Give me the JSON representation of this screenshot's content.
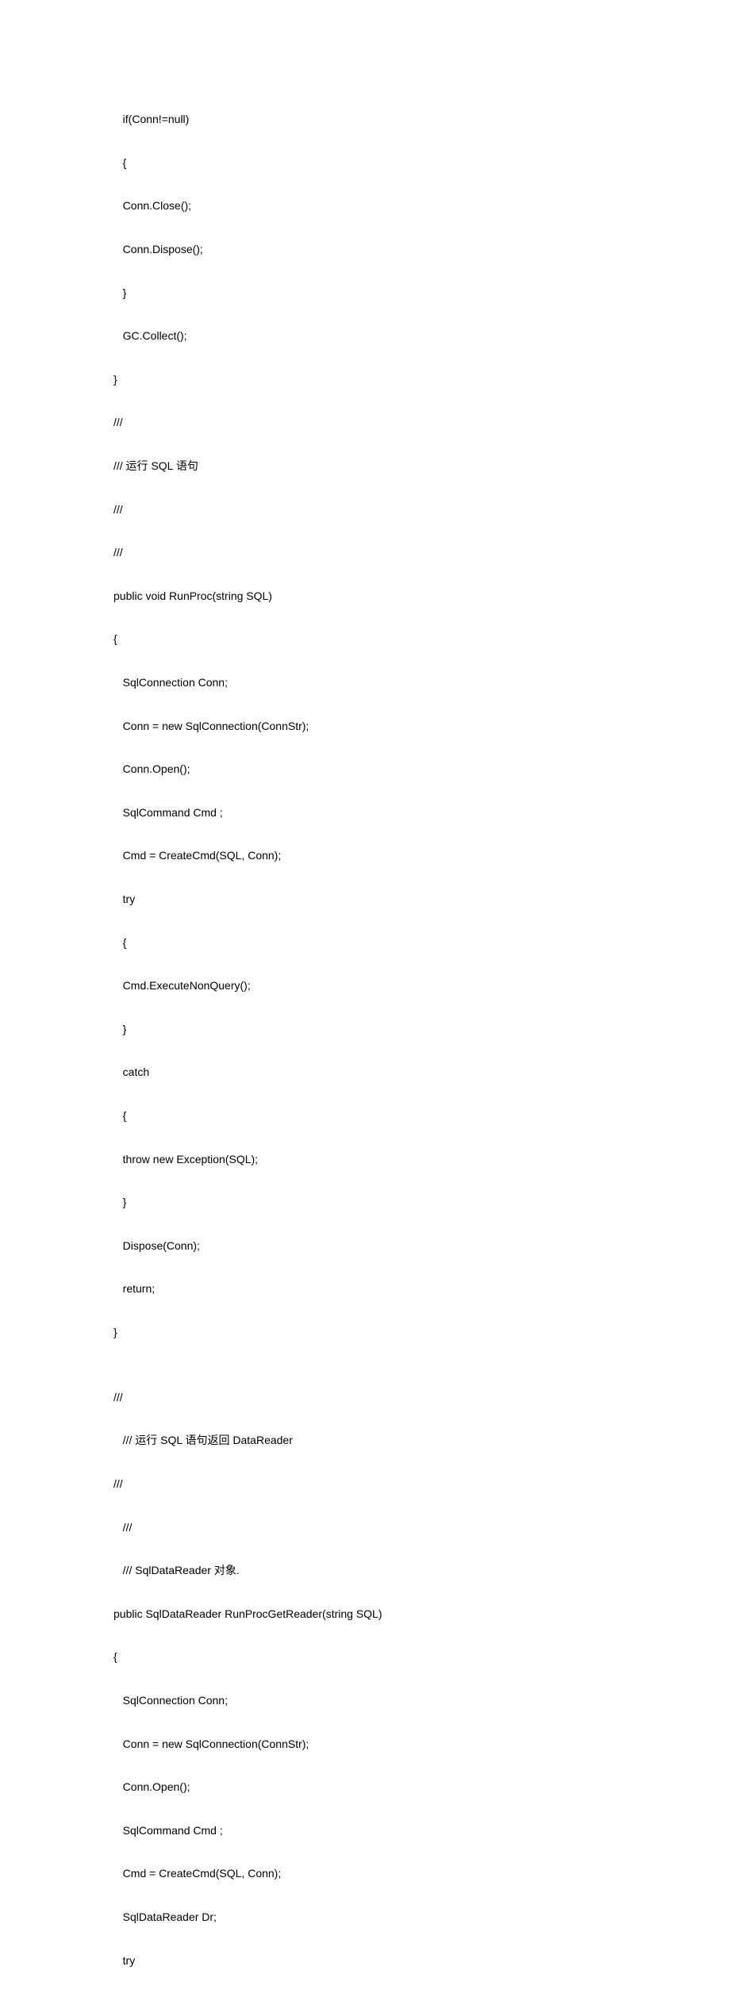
{
  "lines": [
    "   if(Conn!=null)",
    "   {",
    "   Conn.Close();",
    "   Conn.Dispose();",
    "   }",
    "   GC.Collect();",
    "}",
    "///",
    "/// 运行 SQL 语句",
    "///",
    "///",
    "public void RunProc(string SQL)",
    "{",
    "   SqlConnection Conn;",
    "   Conn = new SqlConnection(ConnStr);",
    "   Conn.Open();",
    "   SqlCommand Cmd ;",
    "   Cmd = CreateCmd(SQL, Conn);",
    "   try",
    "   {",
    "   Cmd.ExecuteNonQuery();",
    "   }",
    "   catch",
    "   {",
    "   throw new Exception(SQL);",
    "   }",
    "   Dispose(Conn);",
    "   return;",
    "}",
    "",
    "///",
    "   /// 运行 SQL 语句返回 DataReader",
    "///",
    "   ///",
    "   /// SqlDataReader 对象.",
    "public SqlDataReader RunProcGetReader(string SQL)",
    "{",
    "   SqlConnection Conn;",
    "   Conn = new SqlConnection(ConnStr);",
    "   Conn.Open();",
    "   SqlCommand Cmd ;",
    "   Cmd = CreateCmd(SQL, Conn);",
    "   SqlDataReader Dr;",
    "   try"
  ]
}
